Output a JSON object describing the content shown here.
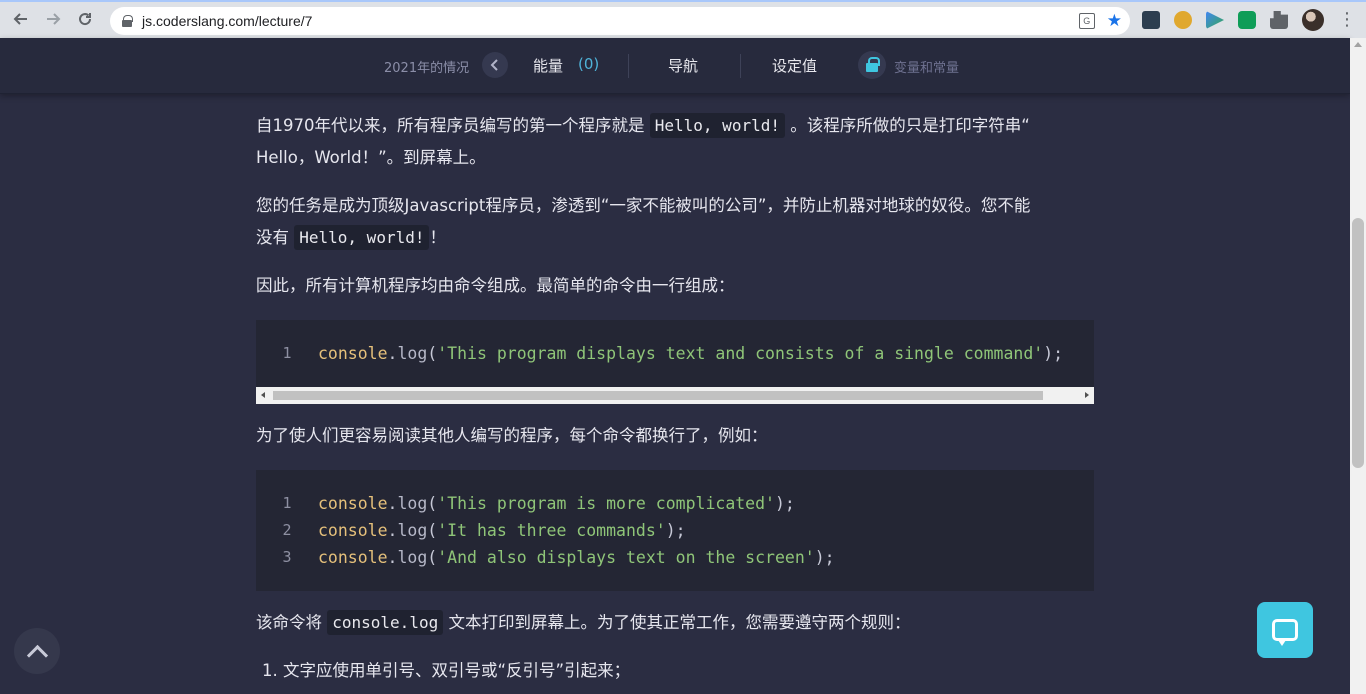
{
  "browser": {
    "url": "js.coderslang.com/lecture/7"
  },
  "header": {
    "prev_lesson": "2021年的情况",
    "energy_label": "能量",
    "energy_count": "(0)",
    "nav_label": "导航",
    "settings_label": "设定值",
    "next_lesson": "变量和常量"
  },
  "content": {
    "p1_a": "自1970年代以来，所有程序员编写的第一个程序就是 ",
    "p1_code": "Hello, world!",
    "p1_b": " 。该程序所做的只是打印字符串“",
    "p1_c": "Hello，World！”。到屏幕上。",
    "p2_a": "您的任务是成为顶级Javascript程序员，渗透到“一家不能被叫的公司”，并防止机器对地球的奴役。您不能",
    "p2_b": "没有 ",
    "p2_code": "Hello, world!",
    "p2_c": "！",
    "p3": "因此，所有计算机程序均由命令组成。最简单的命令由一行组成：",
    "code1": [
      {
        "num": "1",
        "obj": "console",
        "dot": ".",
        "fn": "log",
        "open": "(",
        "str": "'This program displays text and consists of a single command'",
        "close": ");"
      }
    ],
    "p4": "为了使人们更容易阅读其他人编写的程序，每个命令都换行了，例如：",
    "code2": [
      {
        "num": "1",
        "obj": "console",
        "dot": ".",
        "fn": "log",
        "open": "(",
        "str": "'This program is more complicated'",
        "close": ");"
      },
      {
        "num": "2",
        "obj": "console",
        "dot": ".",
        "fn": "log",
        "open": "(",
        "str": "'It has three commands'",
        "close": ");"
      },
      {
        "num": "3",
        "obj": "console",
        "dot": ".",
        "fn": "log",
        "open": "(",
        "str": "'And also displays text on the screen'",
        "close": ");"
      }
    ],
    "p5_a": "该命令将 ",
    "p5_code": "console.log",
    "p5_b": " 文本打印到屏幕上。为了使其正常工作，您需要遵守两个规则：",
    "list_item_1": "1. 文字应使用单引号、双引号或“反引号”引起来；"
  },
  "icons": {
    "back": "back-arrow-icon",
    "forward": "forward-arrow-icon",
    "reload": "reload-icon",
    "lock": "lock-icon",
    "bookmark": "star-icon",
    "scroll_top": "chevron-up-icon",
    "chat": "chat-bubble-icon"
  },
  "colors": {
    "page_bg": "#2b2d42",
    "accent": "#3fc6e0",
    "code_bg": "#242634",
    "string": "#8fc578",
    "object": "#e5c07b"
  }
}
